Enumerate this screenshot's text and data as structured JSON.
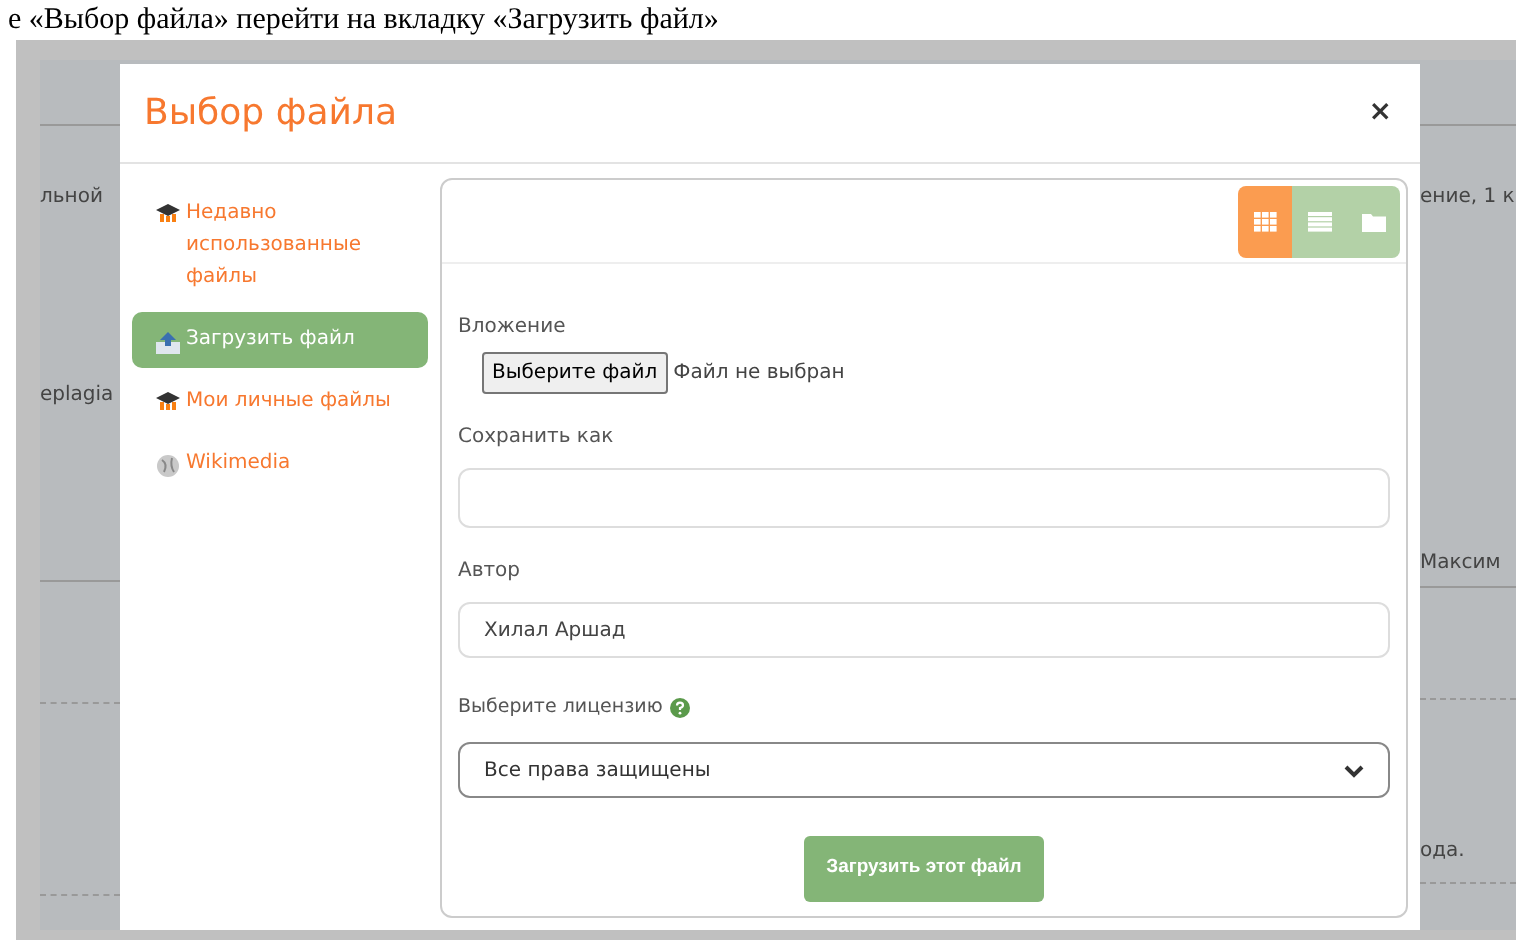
{
  "document_caption": "е «Выбор файла» перейти на вкладку «Загрузить файл»",
  "background": {
    "left_texts": [
      "льной",
      "eplagia"
    ],
    "right_texts": [
      "ение, 1 к",
      "Максим",
      "ода."
    ]
  },
  "dialog": {
    "title": "Выбор файла",
    "close": "×",
    "nav": [
      {
        "label": "Недавно использованные файлы",
        "selected": false,
        "kind": "mortarboard"
      },
      {
        "label": "Загрузить файл",
        "selected": true,
        "kind": "upload"
      },
      {
        "label": "Мои личные файлы",
        "selected": false,
        "kind": "mortarboard"
      },
      {
        "label": "Wikimedia",
        "selected": false,
        "kind": "globe"
      }
    ],
    "views": [
      {
        "kind": "grid",
        "selected": true
      },
      {
        "kind": "list",
        "selected": false
      },
      {
        "kind": "folder",
        "selected": false
      }
    ],
    "form": {
      "attachment_label": "Вложение",
      "file_button": "Выберите файл",
      "file_status": "Файл не выбран",
      "save_as_label": "Сохранить как",
      "author_label": "Автор",
      "author_value": "Хилал Аршад",
      "license_label": "Выберите лицензию",
      "license_value": "Все права защищены",
      "submit": "Загрузить этот файл"
    }
  }
}
